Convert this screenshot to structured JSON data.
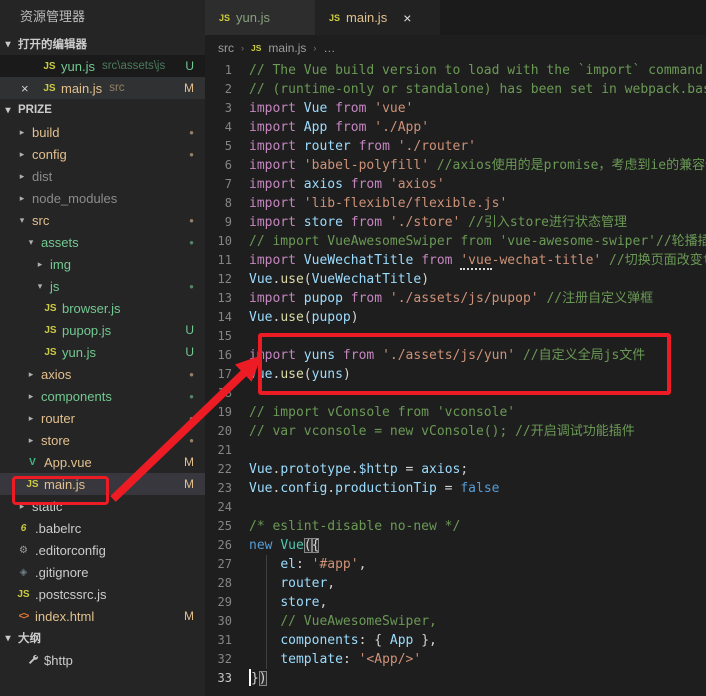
{
  "colors": {
    "annotation_red": "#ed1c24",
    "git_modified": "#e2c08d",
    "git_untracked": "#73c991",
    "editor_bg": "#1e1e1e",
    "sidebar_bg": "#252526"
  },
  "sidebar": {
    "title": "资源管理器",
    "rows": [
      {
        "kind": "header",
        "label": "打开的编辑器"
      },
      {
        "kind": "oe",
        "icon": "js",
        "label": "yun.js",
        "desc": "src\\assets\\js",
        "badge": "U",
        "color": "green",
        "bg": "dark"
      },
      {
        "kind": "oe",
        "close": "×",
        "icon": "js",
        "label": "main.js",
        "desc": "src",
        "badge": "M",
        "color": "gold",
        "bg": "oesel"
      },
      {
        "kind": "header",
        "label": "PRIZE"
      },
      {
        "kind": "item",
        "depth": 1,
        "tw": "c",
        "label": "build",
        "color": "gold",
        "dot": "gold"
      },
      {
        "kind": "item",
        "depth": 1,
        "tw": "c",
        "label": "config",
        "color": "gold",
        "dot": "gold"
      },
      {
        "kind": "item",
        "depth": 1,
        "tw": "c",
        "label": "dist",
        "color": "gray"
      },
      {
        "kind": "item",
        "depth": 1,
        "tw": "c",
        "label": "node_modules",
        "color": "gray"
      },
      {
        "kind": "item",
        "depth": 1,
        "tw": "e",
        "label": "src",
        "color": "gold",
        "dot": "gold"
      },
      {
        "kind": "item",
        "depth": 2,
        "tw": "e",
        "label": "assets",
        "color": "green",
        "dot": "green"
      },
      {
        "kind": "item",
        "depth": 3,
        "tw": "c",
        "label": "img",
        "color": "green"
      },
      {
        "kind": "item",
        "depth": 3,
        "tw": "e",
        "label": "js",
        "color": "green",
        "dot": "green"
      },
      {
        "kind": "item",
        "depth": 4,
        "icon": "js",
        "label": "browser.js",
        "color": "green"
      },
      {
        "kind": "item",
        "depth": 4,
        "icon": "js",
        "label": "pupop.js",
        "color": "green",
        "badge": "U"
      },
      {
        "kind": "item",
        "depth": 4,
        "icon": "js",
        "label": "yun.js",
        "color": "green",
        "badge": "U"
      },
      {
        "kind": "item",
        "depth": 2,
        "tw": "c",
        "label": "axios",
        "color": "gold",
        "dot": "gold"
      },
      {
        "kind": "item",
        "depth": 2,
        "tw": "c",
        "label": "components",
        "color": "green",
        "dot": "green"
      },
      {
        "kind": "item",
        "depth": 2,
        "tw": "c",
        "label": "router",
        "color": "gold",
        "dot": "gold"
      },
      {
        "kind": "item",
        "depth": 2,
        "tw": "c",
        "label": "store",
        "color": "gold",
        "dot": "gold"
      },
      {
        "kind": "item",
        "depth": 2,
        "icon": "vue",
        "label": "App.vue",
        "color": "gold",
        "badge": "M"
      },
      {
        "kind": "item",
        "depth": 2,
        "icon": "js",
        "label": "main.js",
        "color": "gold",
        "badge": "M",
        "bg": "sel"
      },
      {
        "kind": "item",
        "depth": 1,
        "tw": "c",
        "label": "static",
        "color": "def"
      },
      {
        "kind": "item",
        "depth": 1,
        "icon": "babel",
        "label": ".babelrc",
        "color": "def"
      },
      {
        "kind": "item",
        "depth": 1,
        "icon": "gear",
        "label": ".editorconfig",
        "color": "def"
      },
      {
        "kind": "item",
        "depth": 1,
        "icon": "git",
        "label": ".gitignore",
        "color": "def"
      },
      {
        "kind": "item",
        "depth": 1,
        "icon": "js",
        "label": ".postcssrc.js",
        "color": "def"
      },
      {
        "kind": "item",
        "depth": 1,
        "icon": "html",
        "label": "index.html",
        "color": "gold",
        "badge": "M"
      },
      {
        "kind": "header",
        "label": "大纲"
      },
      {
        "kind": "item",
        "depth": 2,
        "icon": "wrench",
        "label": "$http",
        "color": "def"
      }
    ]
  },
  "tabs": [
    {
      "label": "yun.js",
      "icon": "js",
      "active": false
    },
    {
      "label": "main.js",
      "icon": "js",
      "active": true,
      "close": "×"
    }
  ],
  "breadcrumb": {
    "item1": "src",
    "item2": "main.js",
    "item3": "…",
    "sep": "›"
  },
  "editor": {
    "lines": [
      {
        "n": 1,
        "t": [
          [
            "c",
            "// The Vue build version to load with the `import` command"
          ]
        ]
      },
      {
        "n": 2,
        "t": [
          [
            "c",
            "// (runtime-only or standalone) has been set in webpack.base.conf with an alias."
          ]
        ]
      },
      {
        "n": 3,
        "t": [
          [
            "k",
            "import "
          ],
          [
            "v",
            "Vue"
          ],
          [
            "k",
            " from "
          ],
          [
            "s",
            "'vue'"
          ]
        ]
      },
      {
        "n": 4,
        "t": [
          [
            "k",
            "import "
          ],
          [
            "v",
            "App"
          ],
          [
            "k",
            " from "
          ],
          [
            "s",
            "'./App'"
          ]
        ]
      },
      {
        "n": 5,
        "t": [
          [
            "k",
            "import "
          ],
          [
            "v",
            "router"
          ],
          [
            "k",
            " from "
          ],
          [
            "s",
            "'./router'"
          ]
        ]
      },
      {
        "n": 6,
        "t": [
          [
            "k",
            "import "
          ],
          [
            "s",
            "'babel-polyfill'"
          ],
          [
            "c",
            " //axios使用的是promise，考虑到ie的兼容性"
          ]
        ]
      },
      {
        "n": 7,
        "t": [
          [
            "k",
            "import "
          ],
          [
            "v",
            "axios"
          ],
          [
            "k",
            " from "
          ],
          [
            "s",
            "'axios'"
          ]
        ]
      },
      {
        "n": 8,
        "t": [
          [
            "k",
            "import "
          ],
          [
            "s",
            "'lib-flexible/flexible.js'"
          ]
        ]
      },
      {
        "n": 9,
        "t": [
          [
            "k",
            "import "
          ],
          [
            "v",
            "store"
          ],
          [
            "k",
            " from "
          ],
          [
            "s",
            "'./store'"
          ],
          [
            "c",
            " //引入store进行状态管理"
          ]
        ]
      },
      {
        "n": 10,
        "t": [
          [
            "c",
            "// import VueAwesomeSwiper from 'vue-awesome-swiper'//轮播插件"
          ]
        ]
      },
      {
        "n": 11,
        "t": [
          [
            "k",
            "import "
          ],
          [
            "v",
            "VueWechatTitle"
          ],
          [
            "k",
            " from "
          ],
          [
            "sh",
            "'vue"
          ],
          [
            "s",
            "-wechat-title'"
          ],
          [
            "c",
            " //切换页面改变title"
          ]
        ]
      },
      {
        "n": 12,
        "t": [
          [
            "v",
            "Vue"
          ],
          [
            "p",
            "."
          ],
          [
            "f",
            "use"
          ],
          [
            "p",
            "("
          ],
          [
            "v",
            "VueWechatTitle"
          ],
          [
            "p",
            ")"
          ]
        ]
      },
      {
        "n": 13,
        "t": [
          [
            "k",
            "import "
          ],
          [
            "v",
            "pupop"
          ],
          [
            "k",
            " from "
          ],
          [
            "s",
            "'./assets/js/pupop'"
          ],
          [
            "c",
            " //注册自定义弹框"
          ]
        ]
      },
      {
        "n": 14,
        "t": [
          [
            "v",
            "Vue"
          ],
          [
            "p",
            "."
          ],
          [
            "f",
            "use"
          ],
          [
            "p",
            "("
          ],
          [
            "v",
            "pupop"
          ],
          [
            "p",
            ")"
          ]
        ]
      },
      {
        "n": 15,
        "t": []
      },
      {
        "n": 16,
        "t": [
          [
            "k",
            "import "
          ],
          [
            "v",
            "yuns"
          ],
          [
            "k",
            " from "
          ],
          [
            "s",
            "'./assets/js/yun'"
          ],
          [
            "c",
            " //自定义全局js文件"
          ]
        ]
      },
      {
        "n": 17,
        "t": [
          [
            "v",
            "Vue"
          ],
          [
            "p",
            "."
          ],
          [
            "f",
            "use"
          ],
          [
            "p",
            "("
          ],
          [
            "v",
            "yuns"
          ],
          [
            "p",
            ")"
          ]
        ]
      },
      {
        "n": 18,
        "t": []
      },
      {
        "n": 19,
        "t": [
          [
            "c",
            "// import vConsole from 'vconsole'"
          ]
        ]
      },
      {
        "n": 20,
        "t": [
          [
            "c",
            "// var vconsole = new vConsole(); //开启调试功能插件"
          ]
        ]
      },
      {
        "n": 21,
        "t": []
      },
      {
        "n": 22,
        "t": [
          [
            "v",
            "Vue"
          ],
          [
            "p",
            "."
          ],
          [
            "v",
            "prototype"
          ],
          [
            "p",
            "."
          ],
          [
            "v",
            "$http"
          ],
          [
            "p",
            " = "
          ],
          [
            "v",
            "axios"
          ],
          [
            "p",
            ";"
          ]
        ]
      },
      {
        "n": 23,
        "t": [
          [
            "v",
            "Vue"
          ],
          [
            "p",
            "."
          ],
          [
            "v",
            "config"
          ],
          [
            "p",
            "."
          ],
          [
            "v",
            "productionTip"
          ],
          [
            "p",
            " = "
          ],
          [
            "k2",
            "false"
          ]
        ]
      },
      {
        "n": 24,
        "t": []
      },
      {
        "n": 25,
        "t": [
          [
            "c",
            "/* eslint-disable no-new */"
          ]
        ]
      },
      {
        "n": 26,
        "t": [
          [
            "k2",
            "new "
          ],
          [
            "t",
            "Vue"
          ],
          [
            "bm",
            "("
          ],
          [
            "bm",
            "{"
          ]
        ]
      },
      {
        "n": 27,
        "t": [
          [
            "p",
            "    "
          ],
          [
            "v",
            "el"
          ],
          [
            "p",
            ": "
          ],
          [
            "s",
            "'#app'"
          ],
          [
            "p",
            ","
          ]
        ]
      },
      {
        "n": 28,
        "t": [
          [
            "p",
            "    "
          ],
          [
            "v",
            "router"
          ],
          [
            "p",
            ","
          ]
        ]
      },
      {
        "n": 29,
        "t": [
          [
            "p",
            "    "
          ],
          [
            "v",
            "store"
          ],
          [
            "p",
            ","
          ]
        ]
      },
      {
        "n": 30,
        "t": [
          [
            "p",
            "    "
          ],
          [
            "c",
            "// VueAwesomeSwiper,"
          ]
        ]
      },
      {
        "n": 31,
        "t": [
          [
            "p",
            "    "
          ],
          [
            "v",
            "components"
          ],
          [
            "p",
            ": { "
          ],
          [
            "v",
            "App"
          ],
          [
            "p",
            " },"
          ]
        ]
      },
      {
        "n": 32,
        "t": [
          [
            "p",
            "    "
          ],
          [
            "v",
            "template"
          ],
          [
            "p",
            ": "
          ],
          [
            "s",
            "'<App/>'"
          ]
        ]
      },
      {
        "n": 33,
        "t": [
          [
            "cur",
            ""
          ],
          [
            "p",
            "}"
          ],
          [
            "bm",
            ")"
          ]
        ],
        "current": true
      }
    ]
  }
}
